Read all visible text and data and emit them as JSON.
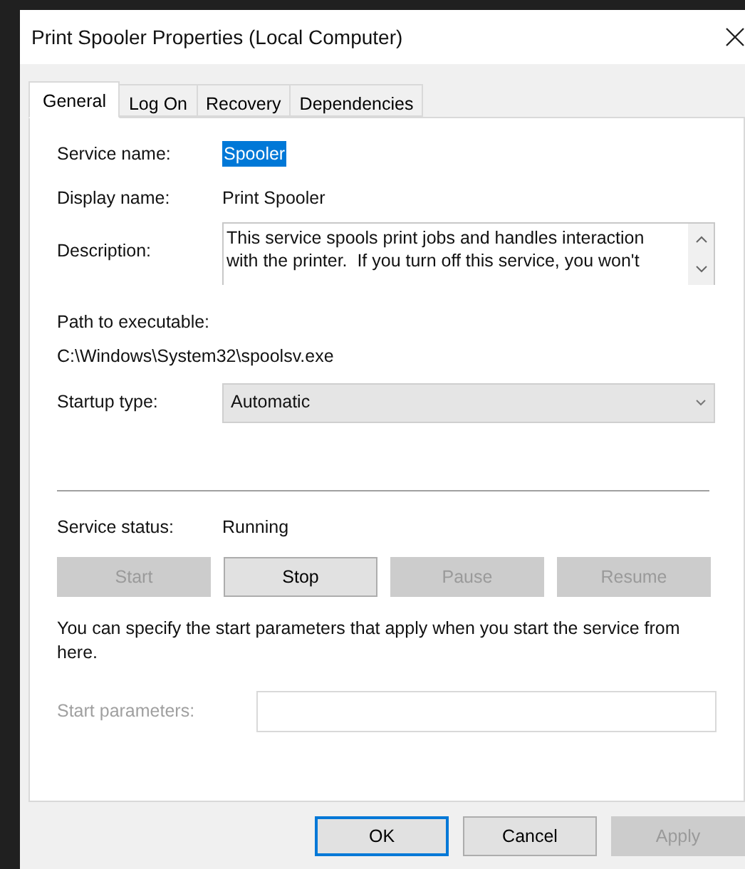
{
  "window": {
    "title": "Print Spooler Properties (Local Computer)"
  },
  "tabs": [
    {
      "label": "General",
      "selected": true
    },
    {
      "label": "Log On",
      "selected": false
    },
    {
      "label": "Recovery",
      "selected": false
    },
    {
      "label": "Dependencies",
      "selected": false
    }
  ],
  "service_name": {
    "label": "Service name:",
    "value": "Spooler",
    "highlighted": true
  },
  "display_name": {
    "label": "Display name:",
    "value": "Print Spooler"
  },
  "description": {
    "label": "Description:",
    "lines": [
      "This service spools print jobs and handles interaction",
      "with the printer.  If you turn off this service, you won't"
    ]
  },
  "path": {
    "label": "Path to executable:",
    "value": "C:\\Windows\\System32\\spoolsv.exe"
  },
  "startup_type": {
    "label": "Startup type:",
    "value": "Automatic"
  },
  "service_status": {
    "label": "Service status:",
    "value": "Running"
  },
  "service_buttons": [
    {
      "label": "Start",
      "disabled": true
    },
    {
      "label": "Stop",
      "disabled": false
    },
    {
      "label": "Pause",
      "disabled": true
    },
    {
      "label": "Resume",
      "disabled": true
    }
  ],
  "hint": "You can specify the start parameters that apply when you start the service from here.",
  "start_parameters": {
    "label": "Start parameters:",
    "disabled": true
  },
  "footer_buttons": [
    {
      "label": "OK",
      "disabled": false,
      "default": true
    },
    {
      "label": "Cancel",
      "disabled": false,
      "default": false
    },
    {
      "label": "Apply",
      "disabled": true,
      "default": false
    }
  ]
}
